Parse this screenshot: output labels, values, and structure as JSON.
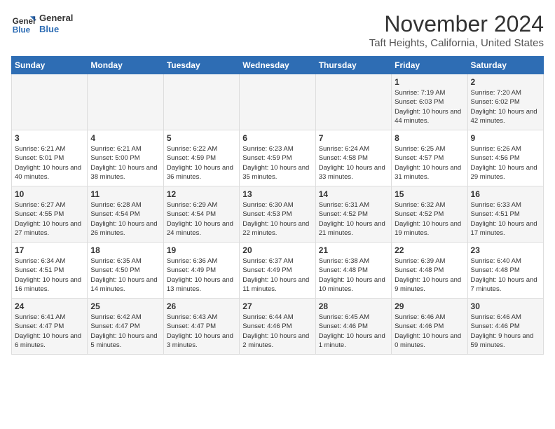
{
  "logo": {
    "line1": "General",
    "line2": "Blue"
  },
  "title": "November 2024",
  "subtitle": "Taft Heights, California, United States",
  "headers": [
    "Sunday",
    "Monday",
    "Tuesday",
    "Wednesday",
    "Thursday",
    "Friday",
    "Saturday"
  ],
  "weeks": [
    [
      {
        "day": "",
        "info": ""
      },
      {
        "day": "",
        "info": ""
      },
      {
        "day": "",
        "info": ""
      },
      {
        "day": "",
        "info": ""
      },
      {
        "day": "",
        "info": ""
      },
      {
        "day": "1",
        "info": "Sunrise: 7:19 AM\nSunset: 6:03 PM\nDaylight: 10 hours and 44 minutes."
      },
      {
        "day": "2",
        "info": "Sunrise: 7:20 AM\nSunset: 6:02 PM\nDaylight: 10 hours and 42 minutes."
      }
    ],
    [
      {
        "day": "3",
        "info": "Sunrise: 6:21 AM\nSunset: 5:01 PM\nDaylight: 10 hours and 40 minutes."
      },
      {
        "day": "4",
        "info": "Sunrise: 6:21 AM\nSunset: 5:00 PM\nDaylight: 10 hours and 38 minutes."
      },
      {
        "day": "5",
        "info": "Sunrise: 6:22 AM\nSunset: 4:59 PM\nDaylight: 10 hours and 36 minutes."
      },
      {
        "day": "6",
        "info": "Sunrise: 6:23 AM\nSunset: 4:59 PM\nDaylight: 10 hours and 35 minutes."
      },
      {
        "day": "7",
        "info": "Sunrise: 6:24 AM\nSunset: 4:58 PM\nDaylight: 10 hours and 33 minutes."
      },
      {
        "day": "8",
        "info": "Sunrise: 6:25 AM\nSunset: 4:57 PM\nDaylight: 10 hours and 31 minutes."
      },
      {
        "day": "9",
        "info": "Sunrise: 6:26 AM\nSunset: 4:56 PM\nDaylight: 10 hours and 29 minutes."
      }
    ],
    [
      {
        "day": "10",
        "info": "Sunrise: 6:27 AM\nSunset: 4:55 PM\nDaylight: 10 hours and 27 minutes."
      },
      {
        "day": "11",
        "info": "Sunrise: 6:28 AM\nSunset: 4:54 PM\nDaylight: 10 hours and 26 minutes."
      },
      {
        "day": "12",
        "info": "Sunrise: 6:29 AM\nSunset: 4:54 PM\nDaylight: 10 hours and 24 minutes."
      },
      {
        "day": "13",
        "info": "Sunrise: 6:30 AM\nSunset: 4:53 PM\nDaylight: 10 hours and 22 minutes."
      },
      {
        "day": "14",
        "info": "Sunrise: 6:31 AM\nSunset: 4:52 PM\nDaylight: 10 hours and 21 minutes."
      },
      {
        "day": "15",
        "info": "Sunrise: 6:32 AM\nSunset: 4:52 PM\nDaylight: 10 hours and 19 minutes."
      },
      {
        "day": "16",
        "info": "Sunrise: 6:33 AM\nSunset: 4:51 PM\nDaylight: 10 hours and 17 minutes."
      }
    ],
    [
      {
        "day": "17",
        "info": "Sunrise: 6:34 AM\nSunset: 4:51 PM\nDaylight: 10 hours and 16 minutes."
      },
      {
        "day": "18",
        "info": "Sunrise: 6:35 AM\nSunset: 4:50 PM\nDaylight: 10 hours and 14 minutes."
      },
      {
        "day": "19",
        "info": "Sunrise: 6:36 AM\nSunset: 4:49 PM\nDaylight: 10 hours and 13 minutes."
      },
      {
        "day": "20",
        "info": "Sunrise: 6:37 AM\nSunset: 4:49 PM\nDaylight: 10 hours and 11 minutes."
      },
      {
        "day": "21",
        "info": "Sunrise: 6:38 AM\nSunset: 4:48 PM\nDaylight: 10 hours and 10 minutes."
      },
      {
        "day": "22",
        "info": "Sunrise: 6:39 AM\nSunset: 4:48 PM\nDaylight: 10 hours and 9 minutes."
      },
      {
        "day": "23",
        "info": "Sunrise: 6:40 AM\nSunset: 4:48 PM\nDaylight: 10 hours and 7 minutes."
      }
    ],
    [
      {
        "day": "24",
        "info": "Sunrise: 6:41 AM\nSunset: 4:47 PM\nDaylight: 10 hours and 6 minutes."
      },
      {
        "day": "25",
        "info": "Sunrise: 6:42 AM\nSunset: 4:47 PM\nDaylight: 10 hours and 5 minutes."
      },
      {
        "day": "26",
        "info": "Sunrise: 6:43 AM\nSunset: 4:47 PM\nDaylight: 10 hours and 3 minutes."
      },
      {
        "day": "27",
        "info": "Sunrise: 6:44 AM\nSunset: 4:46 PM\nDaylight: 10 hours and 2 minutes."
      },
      {
        "day": "28",
        "info": "Sunrise: 6:45 AM\nSunset: 4:46 PM\nDaylight: 10 hours and 1 minute."
      },
      {
        "day": "29",
        "info": "Sunrise: 6:46 AM\nSunset: 4:46 PM\nDaylight: 10 hours and 0 minutes."
      },
      {
        "day": "30",
        "info": "Sunrise: 6:46 AM\nSunset: 4:46 PM\nDaylight: 9 hours and 59 minutes."
      }
    ]
  ]
}
